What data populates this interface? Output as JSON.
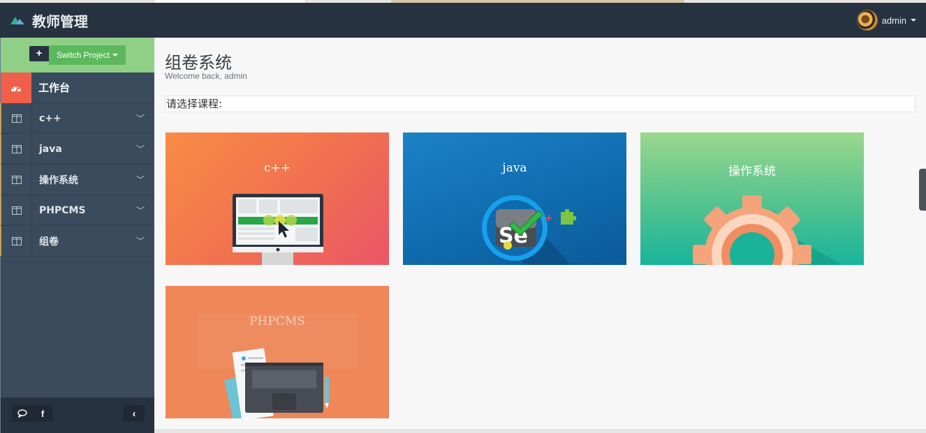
{
  "app": {
    "title": "教师管理",
    "user": "admin"
  },
  "sidebar": {
    "project_button": "Switch Project",
    "plus_label": "+",
    "items": [
      {
        "label": "工作台",
        "icon": "dashboard-icon",
        "active": true
      },
      {
        "label": "c++",
        "icon": "columns-icon"
      },
      {
        "label": "java",
        "icon": "columns-icon"
      },
      {
        "label": "操作系统",
        "icon": "columns-icon"
      },
      {
        "label": "PHPCMS",
        "icon": "columns-icon"
      },
      {
        "label": "组卷",
        "icon": "columns-icon"
      }
    ],
    "footer": {
      "chat": "💬",
      "facebook": "f",
      "collapse": "‹"
    }
  },
  "page": {
    "title": "组卷系统",
    "subtitle": "Welcome back, admin",
    "select_label": "请选择课程:"
  },
  "courses": [
    {
      "title": "c++",
      "color": "#f07050"
    },
    {
      "title": "java",
      "color": "#0f6aad"
    },
    {
      "title": "操作系统",
      "color": "#52c38f"
    },
    {
      "title": "PHPCMS",
      "color": "#ef8759"
    }
  ]
}
